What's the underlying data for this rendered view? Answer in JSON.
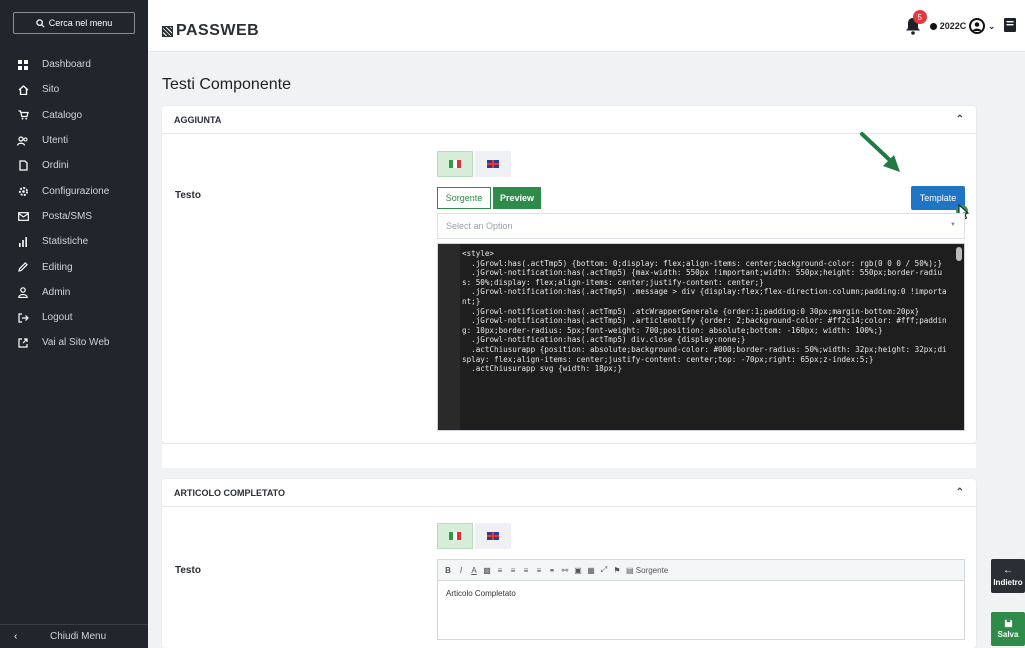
{
  "sidebar": {
    "search_label": "Cerca nel menu",
    "items": [
      {
        "label": "Dashboard",
        "icon": "grid-icon"
      },
      {
        "label": "Sito",
        "icon": "home-icon"
      },
      {
        "label": "Catalogo",
        "icon": "cart-icon"
      },
      {
        "label": "Utenti",
        "icon": "users-icon"
      },
      {
        "label": "Ordini",
        "icon": "file-icon"
      },
      {
        "label": "Configurazione",
        "icon": "gear-icon"
      },
      {
        "label": "Posta/SMS",
        "icon": "mail-icon"
      },
      {
        "label": "Statistiche",
        "icon": "bar-chart-icon"
      },
      {
        "label": "Editing",
        "icon": "pencil-icon"
      },
      {
        "label": "Admin",
        "icon": "person-icon"
      },
      {
        "label": "Logout",
        "icon": "logout-icon"
      },
      {
        "label": "Vai al Sito Web",
        "icon": "external-link-icon"
      }
    ],
    "footer_label": "Chiudi Menu"
  },
  "header": {
    "logo": "PASSWEB",
    "notification_count": "5",
    "user_code": "2022C"
  },
  "page": {
    "title": "Testi Componente"
  },
  "section1": {
    "title": "AGGIUNTA",
    "field_label": "Testo",
    "sorgente_label": "Sorgente",
    "preview_label": "Preview",
    "template_label": "Template",
    "select_placeholder": "Select an Option",
    "code_lines": [
      "<style>",
      "  .jGrowl:has(.actTmp5) {bottom: 0;display: flex;align-items: center;background-color: rgb(0 0 0 / 50%);}",
      "  .jGrowl-notification:has(.actTmp5) {max-width: 550px !important;width: 550px;height: 550px;border-radius: 50%;display: flex;align-items: center;justify-content: center;}",
      "  .jGrowl-notification:has(.actTmp5) .message > div {display:flex;flex-direction:column;padding:0 !important;}",
      "  .jGrowl-notification:has(.actTmp5) .atcWrapperGenerale {order:1;padding:0 30px;margin-bottom:20px}",
      "  .jGrowl-notification:has(.actTmp5) .articlenotify {order: 2;background-color: #ff2c14;color: #fff;padding: 10px;border-radius: 5px;font-weight: 700;position: absolute;bottom: -160px; width: 100%;}",
      "  .jGrowl-notification:has(.actTmp5) div.close {display:none;}",
      "  .actChiusurapp {position: absolute;background-color: #000;border-radius: 50%;width: 32px;height: 32px;display: flex;align-items: center;justify-content: center;top: -70px;right: 65px;z-index:5;}",
      "  .actChiusurapp svg {width: 18px;}"
    ]
  },
  "section2": {
    "title": "ARTICOLO COMPLETATO",
    "field_label": "Testo",
    "editor_source_label": "Sorgente",
    "editor_content": "Articolo Completato"
  },
  "actions": {
    "back_label": "Indietro",
    "save_label": "Salva"
  },
  "colors": {
    "sidebar_bg": "#22252b",
    "primary_green": "#2e8b4a",
    "template_blue": "#1f74c4",
    "badge_red": "#e0393e"
  }
}
